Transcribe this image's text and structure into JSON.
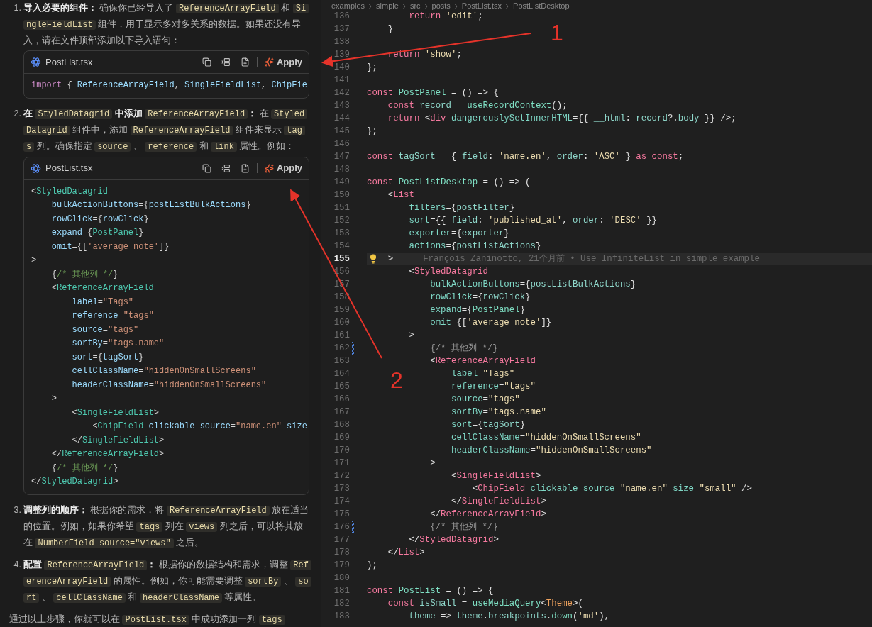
{
  "chat": {
    "steps": [
      {
        "number": "1.",
        "segments": [
          {
            "kind": "bold",
            "text": "导入必要的组件："
          },
          {
            "kind": "text",
            "text": " 确保你已经导入了 "
          },
          {
            "kind": "code",
            "text": "ReferenceArrayField"
          },
          {
            "kind": "text",
            "text": " 和 "
          },
          {
            "kind": "code",
            "text": "SingleFieldList"
          },
          {
            "kind": "text",
            "text": " 组件，用于显示多对多关系的数据。如果还没有导入，请在文件顶部添加以下导入语句："
          }
        ],
        "code_block": {
          "filename": "PostList.tsx",
          "action": "Apply",
          "lines": [
            {
              "tokens": [
                {
                  "kind": "kw",
                  "text": "import"
                },
                {
                  "kind": "p",
                  "text": " { "
                },
                {
                  "kind": "attr",
                  "text": "ReferenceArrayField"
                },
                {
                  "kind": "p",
                  "text": ", "
                },
                {
                  "kind": "attr",
                  "text": "SingleFieldList"
                },
                {
                  "kind": "p",
                  "text": ", "
                },
                {
                  "kind": "attr",
                  "text": "ChipFie"
                }
              ]
            }
          ]
        }
      },
      {
        "number": "2.",
        "segments": [
          {
            "kind": "bold",
            "text": "在 "
          },
          {
            "kind": "code",
            "text": "StyledDatagrid"
          },
          {
            "kind": "bold",
            "text": " 中添加 "
          },
          {
            "kind": "code",
            "text": "ReferenceArrayField"
          },
          {
            "kind": "bold",
            "text": "："
          },
          {
            "kind": "text",
            "text": " 在 "
          },
          {
            "kind": "code",
            "text": "StyledDatagrid"
          },
          {
            "kind": "text",
            "text": " 组件中，添加 "
          },
          {
            "kind": "code",
            "text": "ReferenceArrayField"
          },
          {
            "kind": "text",
            "text": " 组件来显示 "
          },
          {
            "kind": "code",
            "text": "tags"
          },
          {
            "kind": "text",
            "text": " 列。确保指定 "
          },
          {
            "kind": "code",
            "text": "source"
          },
          {
            "kind": "text",
            "text": " 、 "
          },
          {
            "kind": "code",
            "text": "reference"
          },
          {
            "kind": "text",
            "text": " 和 "
          },
          {
            "kind": "code",
            "text": "link"
          },
          {
            "kind": "text",
            "text": " 属性。例如："
          }
        ],
        "code_block": {
          "filename": "PostList.tsx",
          "action": "Apply",
          "lines": [
            {
              "tokens": [
                {
                  "kind": "p",
                  "text": "<"
                },
                {
                  "kind": "tag",
                  "text": "StyledDatagrid"
                }
              ]
            },
            {
              "tokens": [
                {
                  "kind": "attr",
                  "text": "    bulkActionButtons"
                },
                {
                  "kind": "p",
                  "text": "={"
                },
                {
                  "kind": "id",
                  "text": "postListBulkActions"
                },
                {
                  "kind": "p",
                  "text": "}"
                }
              ]
            },
            {
              "tokens": [
                {
                  "kind": "attr",
                  "text": "    rowClick"
                },
                {
                  "kind": "p",
                  "text": "={"
                },
                {
                  "kind": "id",
                  "text": "rowClick"
                },
                {
                  "kind": "p",
                  "text": "}"
                }
              ]
            },
            {
              "tokens": [
                {
                  "kind": "attr",
                  "text": "    expand"
                },
                {
                  "kind": "p",
                  "text": "={"
                },
                {
                  "kind": "tag",
                  "text": "PostPanel"
                },
                {
                  "kind": "p",
                  "text": "}"
                }
              ]
            },
            {
              "tokens": [
                {
                  "kind": "attr",
                  "text": "    omit"
                },
                {
                  "kind": "p",
                  "text": "={["
                },
                {
                  "kind": "str",
                  "text": "'average_note'"
                },
                {
                  "kind": "p",
                  "text": "]}"
                }
              ]
            },
            {
              "tokens": [
                {
                  "kind": "p",
                  "text": ">"
                }
              ]
            },
            {
              "tokens": [
                {
                  "kind": "p",
                  "text": "    {"
                },
                {
                  "kind": "cmt",
                  "text": "/* 其他列 */"
                },
                {
                  "kind": "p",
                  "text": "}"
                }
              ]
            },
            {
              "tokens": [
                {
                  "kind": "p",
                  "text": "    <"
                },
                {
                  "kind": "tag",
                  "text": "ReferenceArrayField"
                }
              ]
            },
            {
              "tokens": [
                {
                  "kind": "attr",
                  "text": "        label"
                },
                {
                  "kind": "p",
                  "text": "="
                },
                {
                  "kind": "str",
                  "text": "\"Tags\""
                }
              ]
            },
            {
              "tokens": [
                {
                  "kind": "attr",
                  "text": "        reference"
                },
                {
                  "kind": "p",
                  "text": "="
                },
                {
                  "kind": "str",
                  "text": "\"tags\""
                }
              ]
            },
            {
              "tokens": [
                {
                  "kind": "attr",
                  "text": "        source"
                },
                {
                  "kind": "p",
                  "text": "="
                },
                {
                  "kind": "str",
                  "text": "\"tags\""
                }
              ]
            },
            {
              "tokens": [
                {
                  "kind": "attr",
                  "text": "        sortBy"
                },
                {
                  "kind": "p",
                  "text": "="
                },
                {
                  "kind": "str",
                  "text": "\"tags.name\""
                }
              ]
            },
            {
              "tokens": [
                {
                  "kind": "attr",
                  "text": "        sort"
                },
                {
                  "kind": "p",
                  "text": "={"
                },
                {
                  "kind": "id",
                  "text": "tagSort"
                },
                {
                  "kind": "p",
                  "text": "}"
                }
              ]
            },
            {
              "tokens": [
                {
                  "kind": "attr",
                  "text": "        cellClassName"
                },
                {
                  "kind": "p",
                  "text": "="
                },
                {
                  "kind": "str",
                  "text": "\"hiddenOnSmallScreens\""
                }
              ]
            },
            {
              "tokens": [
                {
                  "kind": "attr",
                  "text": "        headerClassName"
                },
                {
                  "kind": "p",
                  "text": "="
                },
                {
                  "kind": "str",
                  "text": "\"hiddenOnSmallScreens\""
                }
              ]
            },
            {
              "tokens": [
                {
                  "kind": "p",
                  "text": "    >"
                }
              ]
            },
            {
              "tokens": [
                {
                  "kind": "p",
                  "text": "        <"
                },
                {
                  "kind": "tag",
                  "text": "SingleFieldList"
                },
                {
                  "kind": "p",
                  "text": ">"
                }
              ]
            },
            {
              "tokens": [
                {
                  "kind": "p",
                  "text": "            <"
                },
                {
                  "kind": "tag",
                  "text": "ChipField"
                },
                {
                  "kind": "attr",
                  "text": " clickable source"
                },
                {
                  "kind": "p",
                  "text": "="
                },
                {
                  "kind": "str",
                  "text": "\"name.en\""
                },
                {
                  "kind": "attr",
                  "text": " size"
                }
              ]
            },
            {
              "tokens": [
                {
                  "kind": "p",
                  "text": "        </"
                },
                {
                  "kind": "tag",
                  "text": "SingleFieldList"
                },
                {
                  "kind": "p",
                  "text": ">"
                }
              ]
            },
            {
              "tokens": [
                {
                  "kind": "p",
                  "text": "    </"
                },
                {
                  "kind": "tag",
                  "text": "ReferenceArrayField"
                },
                {
                  "kind": "p",
                  "text": ">"
                }
              ]
            },
            {
              "tokens": [
                {
                  "kind": "p",
                  "text": "    {"
                },
                {
                  "kind": "cmt",
                  "text": "/* 其他列 */"
                },
                {
                  "kind": "p",
                  "text": "}"
                }
              ]
            },
            {
              "tokens": [
                {
                  "kind": "p",
                  "text": "</"
                },
                {
                  "kind": "tag",
                  "text": "StyledDatagrid"
                },
                {
                  "kind": "p",
                  "text": ">"
                }
              ]
            }
          ]
        }
      },
      {
        "number": "3.",
        "segments": [
          {
            "kind": "bold",
            "text": "调整列的顺序："
          },
          {
            "kind": "text",
            "text": " 根据你的需求，将 "
          },
          {
            "kind": "code",
            "text": "ReferenceArrayField"
          },
          {
            "kind": "text",
            "text": " 放在适当的位置。例如，如果你希望 "
          },
          {
            "kind": "code",
            "text": "tags"
          },
          {
            "kind": "text",
            "text": " 列在 "
          },
          {
            "kind": "code",
            "text": "views"
          },
          {
            "kind": "text",
            "text": " 列之后，可以将其放在 "
          },
          {
            "kind": "code",
            "text": "NumberField source=\"views\""
          },
          {
            "kind": "text",
            "text": " 之后。"
          }
        ]
      },
      {
        "number": "4.",
        "segments": [
          {
            "kind": "bold",
            "text": "配置 "
          },
          {
            "kind": "code",
            "text": "ReferenceArrayField"
          },
          {
            "kind": "bold",
            "text": "："
          },
          {
            "kind": "text",
            "text": " 根据你的数据结构和需求，调整 "
          },
          {
            "kind": "code",
            "text": "ReferenceArrayField"
          },
          {
            "kind": "text",
            "text": " 的属性。例如，你可能需要调整 "
          },
          {
            "kind": "code",
            "text": "sortBy"
          },
          {
            "kind": "text",
            "text": " 、 "
          },
          {
            "kind": "code",
            "text": "sort"
          },
          {
            "kind": "text",
            "text": " 、 "
          },
          {
            "kind": "code",
            "text": "cellClassName"
          },
          {
            "kind": "text",
            "text": " 和 "
          },
          {
            "kind": "code",
            "text": "headerClassName"
          },
          {
            "kind": "text",
            "text": " 等属性。"
          }
        ]
      }
    ],
    "summary": {
      "segments": [
        {
          "kind": "text",
          "text": "通过以上步骤，你就可以在 "
        },
        {
          "kind": "code",
          "text": "PostList.tsx"
        },
        {
          "kind": "text",
          "text": " 中成功添加一列 "
        },
        {
          "kind": "code",
          "text": "tags"
        }
      ]
    }
  },
  "editor": {
    "breadcrumb": [
      "examples",
      "simple",
      "src",
      "posts",
      "PostList.tsx",
      "PostListDesktop"
    ],
    "lines": [
      {
        "n": "136",
        "current": false,
        "changed": false,
        "tokens": [
          {
            "kind": "kw",
            "text": "        return "
          },
          {
            "kind": "str",
            "text": "'edit'"
          },
          {
            "kind": "p",
            "text": ";"
          }
        ]
      },
      {
        "n": "137",
        "current": false,
        "changed": false,
        "tokens": [
          {
            "kind": "p",
            "text": "    }"
          }
        ]
      },
      {
        "n": "138",
        "current": false,
        "changed": false
      },
      {
        "n": "139",
        "current": false,
        "changed": false,
        "tokens": [
          {
            "kind": "kw",
            "text": "    return "
          },
          {
            "kind": "str",
            "text": "'show'"
          },
          {
            "kind": "p",
            "text": ";"
          }
        ]
      },
      {
        "n": "140",
        "current": false,
        "changed": false,
        "tokens": [
          {
            "kind": "p",
            "text": "};"
          }
        ]
      },
      {
        "n": "141",
        "current": false,
        "changed": false
      },
      {
        "n": "142",
        "current": false,
        "changed": false,
        "tokens": [
          {
            "kind": "kw",
            "text": "const "
          },
          {
            "kind": "fn",
            "text": "PostPanel"
          },
          {
            "kind": "p",
            "text": " = () => {"
          }
        ]
      },
      {
        "n": "143",
        "current": false,
        "changed": false,
        "tokens": [
          {
            "kind": "kw",
            "text": "    const "
          },
          {
            "kind": "id",
            "text": "record"
          },
          {
            "kind": "p",
            "text": " = "
          },
          {
            "kind": "fn",
            "text": "useRecordContext"
          },
          {
            "kind": "p",
            "text": "();"
          }
        ]
      },
      {
        "n": "144",
        "current": false,
        "changed": false,
        "tokens": [
          {
            "kind": "kw",
            "text": "    return "
          },
          {
            "kind": "p",
            "text": "<"
          },
          {
            "kind": "tag",
            "text": "div "
          },
          {
            "kind": "attr",
            "text": "dangerouslySetInnerHTML"
          },
          {
            "kind": "p",
            "text": "={{ "
          },
          {
            "kind": "id",
            "text": "__html"
          },
          {
            "kind": "p",
            "text": ": "
          },
          {
            "kind": "id",
            "text": "record"
          },
          {
            "kind": "p",
            "text": "?."
          },
          {
            "kind": "id",
            "text": "body"
          },
          {
            "kind": "p",
            "text": " }} />;"
          }
        ]
      },
      {
        "n": "145",
        "current": false,
        "changed": false,
        "tokens": [
          {
            "kind": "p",
            "text": "};"
          }
        ]
      },
      {
        "n": "146",
        "current": false,
        "changed": false
      },
      {
        "n": "147",
        "current": false,
        "changed": false,
        "tokens": [
          {
            "kind": "kw",
            "text": "const "
          },
          {
            "kind": "id",
            "text": "tagSort"
          },
          {
            "kind": "p",
            "text": " = { "
          },
          {
            "kind": "id",
            "text": "field"
          },
          {
            "kind": "p",
            "text": ": "
          },
          {
            "kind": "str",
            "text": "'name.en'"
          },
          {
            "kind": "p",
            "text": ", "
          },
          {
            "kind": "id",
            "text": "order"
          },
          {
            "kind": "p",
            "text": ": "
          },
          {
            "kind": "str",
            "text": "'ASC'"
          },
          {
            "kind": "p",
            "text": " } "
          },
          {
            "kind": "kw",
            "text": "as const"
          },
          {
            "kind": "p",
            "text": ";"
          }
        ]
      },
      {
        "n": "148",
        "current": false,
        "changed": false
      },
      {
        "n": "149",
        "current": false,
        "changed": false,
        "tokens": [
          {
            "kind": "kw",
            "text": "const "
          },
          {
            "kind": "fn",
            "text": "PostListDesktop"
          },
          {
            "kind": "p",
            "text": " = () => ("
          }
        ]
      },
      {
        "n": "150",
        "current": false,
        "changed": false,
        "tokens": [
          {
            "kind": "p",
            "text": "    <"
          },
          {
            "kind": "tag",
            "text": "List"
          }
        ]
      },
      {
        "n": "151",
        "current": false,
        "changed": false,
        "tokens": [
          {
            "kind": "attr",
            "text": "        filters"
          },
          {
            "kind": "p",
            "text": "={"
          },
          {
            "kind": "id",
            "text": "postFilter"
          },
          {
            "kind": "p",
            "text": "}"
          }
        ]
      },
      {
        "n": "152",
        "current": false,
        "changed": false,
        "tokens": [
          {
            "kind": "attr",
            "text": "        sort"
          },
          {
            "kind": "p",
            "text": "={{ "
          },
          {
            "kind": "id",
            "text": "field"
          },
          {
            "kind": "p",
            "text": ": "
          },
          {
            "kind": "str",
            "text": "'published_at'"
          },
          {
            "kind": "p",
            "text": ", "
          },
          {
            "kind": "id",
            "text": "order"
          },
          {
            "kind": "p",
            "text": ": "
          },
          {
            "kind": "str",
            "text": "'DESC'"
          },
          {
            "kind": "p",
            "text": " }}"
          }
        ]
      },
      {
        "n": "153",
        "current": false,
        "changed": false,
        "tokens": [
          {
            "kind": "attr",
            "text": "        exporter"
          },
          {
            "kind": "p",
            "text": "={"
          },
          {
            "kind": "id",
            "text": "exporter"
          },
          {
            "kind": "p",
            "text": "}"
          }
        ]
      },
      {
        "n": "154",
        "current": false,
        "changed": false,
        "tokens": [
          {
            "kind": "attr",
            "text": "        actions"
          },
          {
            "kind": "p",
            "text": "={"
          },
          {
            "kind": "id",
            "text": "postListActions"
          },
          {
            "kind": "p",
            "text": "}"
          }
        ]
      },
      {
        "n": "155",
        "current": true,
        "changed": false,
        "lightbulb": true,
        "blame": "François Zaninotto, 21个月前 • Use InfiniteList in simple example",
        "tokens": [
          {
            "kind": "p",
            "text": "    >"
          }
        ]
      },
      {
        "n": "156",
        "current": false,
        "changed": false,
        "tokens": [
          {
            "kind": "p",
            "text": "        <"
          },
          {
            "kind": "tag",
            "text": "StyledDatagrid"
          }
        ]
      },
      {
        "n": "157",
        "current": false,
        "changed": false,
        "tokens": [
          {
            "kind": "attr",
            "text": "            bulkActionButtons"
          },
          {
            "kind": "p",
            "text": "={"
          },
          {
            "kind": "id",
            "text": "postListBulkActions"
          },
          {
            "kind": "p",
            "text": "}"
          }
        ]
      },
      {
        "n": "158",
        "current": false,
        "changed": false,
        "tokens": [
          {
            "kind": "attr",
            "text": "            rowClick"
          },
          {
            "kind": "p",
            "text": "={"
          },
          {
            "kind": "id",
            "text": "rowClick"
          },
          {
            "kind": "p",
            "text": "}"
          }
        ]
      },
      {
        "n": "159",
        "current": false,
        "changed": false,
        "tokens": [
          {
            "kind": "attr",
            "text": "            expand"
          },
          {
            "kind": "p",
            "text": "={"
          },
          {
            "kind": "fn",
            "text": "PostPanel"
          },
          {
            "kind": "p",
            "text": "}"
          }
        ]
      },
      {
        "n": "160",
        "current": false,
        "changed": false,
        "tokens": [
          {
            "kind": "attr",
            "text": "            omit"
          },
          {
            "kind": "p",
            "text": "={["
          },
          {
            "kind": "str",
            "text": "'average_note'"
          },
          {
            "kind": "p",
            "text": "]}"
          }
        ]
      },
      {
        "n": "161",
        "current": false,
        "changed": false,
        "tokens": [
          {
            "kind": "p",
            "text": "        >"
          }
        ]
      },
      {
        "n": "162",
        "current": false,
        "changed": true,
        "tokens": [
          {
            "kind": "cmt",
            "text": "            {/* 其他列 */}"
          }
        ]
      },
      {
        "n": "163",
        "current": false,
        "changed": false,
        "tokens": [
          {
            "kind": "p",
            "text": "            <"
          },
          {
            "kind": "tag",
            "text": "ReferenceArrayField"
          }
        ]
      },
      {
        "n": "164",
        "current": false,
        "changed": false,
        "tokens": [
          {
            "kind": "attr",
            "text": "                label"
          },
          {
            "kind": "p",
            "text": "="
          },
          {
            "kind": "str",
            "text": "\"Tags\""
          }
        ]
      },
      {
        "n": "165",
        "current": false,
        "changed": false,
        "tokens": [
          {
            "kind": "attr",
            "text": "                reference"
          },
          {
            "kind": "p",
            "text": "="
          },
          {
            "kind": "str",
            "text": "\"tags\""
          }
        ]
      },
      {
        "n": "166",
        "current": false,
        "changed": false,
        "tokens": [
          {
            "kind": "attr",
            "text": "                source"
          },
          {
            "kind": "p",
            "text": "="
          },
          {
            "kind": "str",
            "text": "\"tags\""
          }
        ]
      },
      {
        "n": "167",
        "current": false,
        "changed": false,
        "tokens": [
          {
            "kind": "attr",
            "text": "                sortBy"
          },
          {
            "kind": "p",
            "text": "="
          },
          {
            "kind": "str",
            "text": "\"tags.name\""
          }
        ]
      },
      {
        "n": "168",
        "current": false,
        "changed": false,
        "tokens": [
          {
            "kind": "attr",
            "text": "                sort"
          },
          {
            "kind": "p",
            "text": "={"
          },
          {
            "kind": "id",
            "text": "tagSort"
          },
          {
            "kind": "p",
            "text": "}"
          }
        ]
      },
      {
        "n": "169",
        "current": false,
        "changed": false,
        "tokens": [
          {
            "kind": "attr",
            "text": "                cellClassName"
          },
          {
            "kind": "p",
            "text": "="
          },
          {
            "kind": "str",
            "text": "\"hiddenOnSmallScreens\""
          }
        ]
      },
      {
        "n": "170",
        "current": false,
        "changed": false,
        "tokens": [
          {
            "kind": "attr",
            "text": "                headerClassName"
          },
          {
            "kind": "p",
            "text": "="
          },
          {
            "kind": "str",
            "text": "\"hiddenOnSmallScreens\""
          }
        ]
      },
      {
        "n": "171",
        "current": false,
        "changed": false,
        "tokens": [
          {
            "kind": "p",
            "text": "            >"
          }
        ]
      },
      {
        "n": "172",
        "current": false,
        "changed": false,
        "tokens": [
          {
            "kind": "p",
            "text": "                <"
          },
          {
            "kind": "tag",
            "text": "SingleFieldList"
          },
          {
            "kind": "p",
            "text": ">"
          }
        ]
      },
      {
        "n": "173",
        "current": false,
        "changed": false,
        "tokens": [
          {
            "kind": "p",
            "text": "                    <"
          },
          {
            "kind": "tag",
            "text": "ChipField "
          },
          {
            "kind": "attr",
            "text": "clickable source"
          },
          {
            "kind": "p",
            "text": "="
          },
          {
            "kind": "str",
            "text": "\"name.en\""
          },
          {
            "kind": "attr",
            "text": " size"
          },
          {
            "kind": "p",
            "text": "="
          },
          {
            "kind": "str",
            "text": "\"small\""
          },
          {
            "kind": "p",
            "text": " />"
          }
        ]
      },
      {
        "n": "174",
        "current": false,
        "changed": false,
        "tokens": [
          {
            "kind": "p",
            "text": "                </"
          },
          {
            "kind": "tag",
            "text": "SingleFieldList"
          },
          {
            "kind": "p",
            "text": ">"
          }
        ]
      },
      {
        "n": "175",
        "current": false,
        "changed": false,
        "tokens": [
          {
            "kind": "p",
            "text": "            </"
          },
          {
            "kind": "tag",
            "text": "ReferenceArrayField"
          },
          {
            "kind": "p",
            "text": ">"
          }
        ]
      },
      {
        "n": "176",
        "current": false,
        "changed": true,
        "tokens": [
          {
            "kind": "cmt",
            "text": "            {/* 其他列 */}"
          }
        ]
      },
      {
        "n": "177",
        "current": false,
        "changed": false,
        "tokens": [
          {
            "kind": "p",
            "text": "        </"
          },
          {
            "kind": "tag",
            "text": "StyledDatagrid"
          },
          {
            "kind": "p",
            "text": ">"
          }
        ]
      },
      {
        "n": "178",
        "current": false,
        "changed": false,
        "tokens": [
          {
            "kind": "p",
            "text": "    </"
          },
          {
            "kind": "tag",
            "text": "List"
          },
          {
            "kind": "p",
            "text": ">"
          }
        ]
      },
      {
        "n": "179",
        "current": false,
        "changed": false,
        "tokens": [
          {
            "kind": "p",
            "text": ");"
          }
        ]
      },
      {
        "n": "180",
        "current": false,
        "changed": false
      },
      {
        "n": "181",
        "current": false,
        "changed": false,
        "tokens": [
          {
            "kind": "kw",
            "text": "const "
          },
          {
            "kind": "fn",
            "text": "PostList"
          },
          {
            "kind": "p",
            "text": " = () => {"
          }
        ]
      },
      {
        "n": "182",
        "current": false,
        "changed": false,
        "tokens": [
          {
            "kind": "kw",
            "text": "    const "
          },
          {
            "kind": "id",
            "text": "isSmall"
          },
          {
            "kind": "p",
            "text": " = "
          },
          {
            "kind": "fn",
            "text": "useMediaQuery"
          },
          {
            "kind": "p",
            "text": "<"
          },
          {
            "kind": "type",
            "text": "Theme"
          },
          {
            "kind": "p",
            "text": ">("
          }
        ]
      },
      {
        "n": "183",
        "current": false,
        "changed": false,
        "tokens": [
          {
            "kind": "id",
            "text": "        theme"
          },
          {
            "kind": "p",
            "text": " => "
          },
          {
            "kind": "id",
            "text": "theme"
          },
          {
            "kind": "p",
            "text": "."
          },
          {
            "kind": "id",
            "text": "breakpoints"
          },
          {
            "kind": "p",
            "text": "."
          },
          {
            "kind": "fn",
            "text": "down"
          },
          {
            "kind": "p",
            "text": "("
          },
          {
            "kind": "str",
            "text": "'md'"
          },
          {
            "kind": "p",
            "text": "),"
          }
        ]
      }
    ]
  },
  "annotations": [
    {
      "label": "1"
    },
    {
      "label": "2"
    }
  ]
}
